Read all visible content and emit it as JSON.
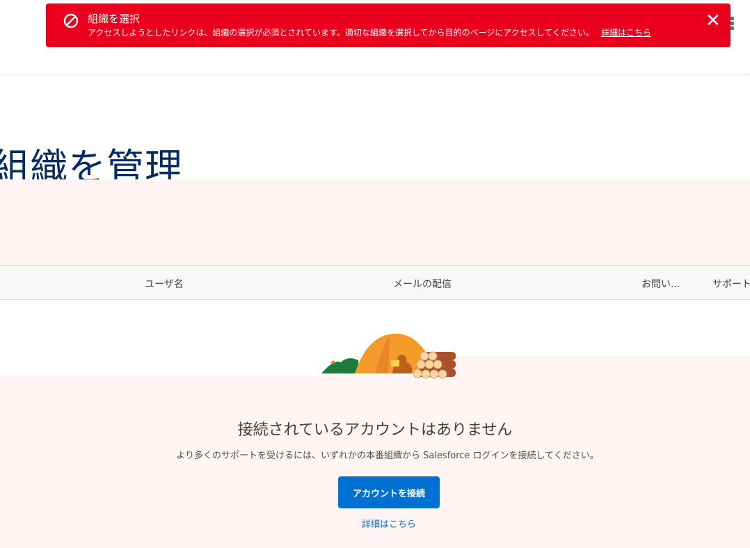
{
  "toast": {
    "icon": "ban-icon",
    "title": "組織を選択",
    "message": "アクセスしようとしたリンクは、組織の選択が必須とされています。適切な組織を選択してから目的のページにアクセスしてください。",
    "link": "詳細はこちら",
    "color": "#ea001e"
  },
  "page": {
    "title": "組織を管理"
  },
  "table": {
    "columns": [
      "ユーザ名",
      "メールの配信",
      "お問い...",
      "サポート"
    ]
  },
  "empty_state": {
    "title": "接続されているアカウントはありません",
    "subtitle": "より多くのサポートを受けるには、いずれかの本番組織から Salesforce ログインを接続してください。",
    "button": "アカウントを接続",
    "link": "詳細はこちら"
  }
}
